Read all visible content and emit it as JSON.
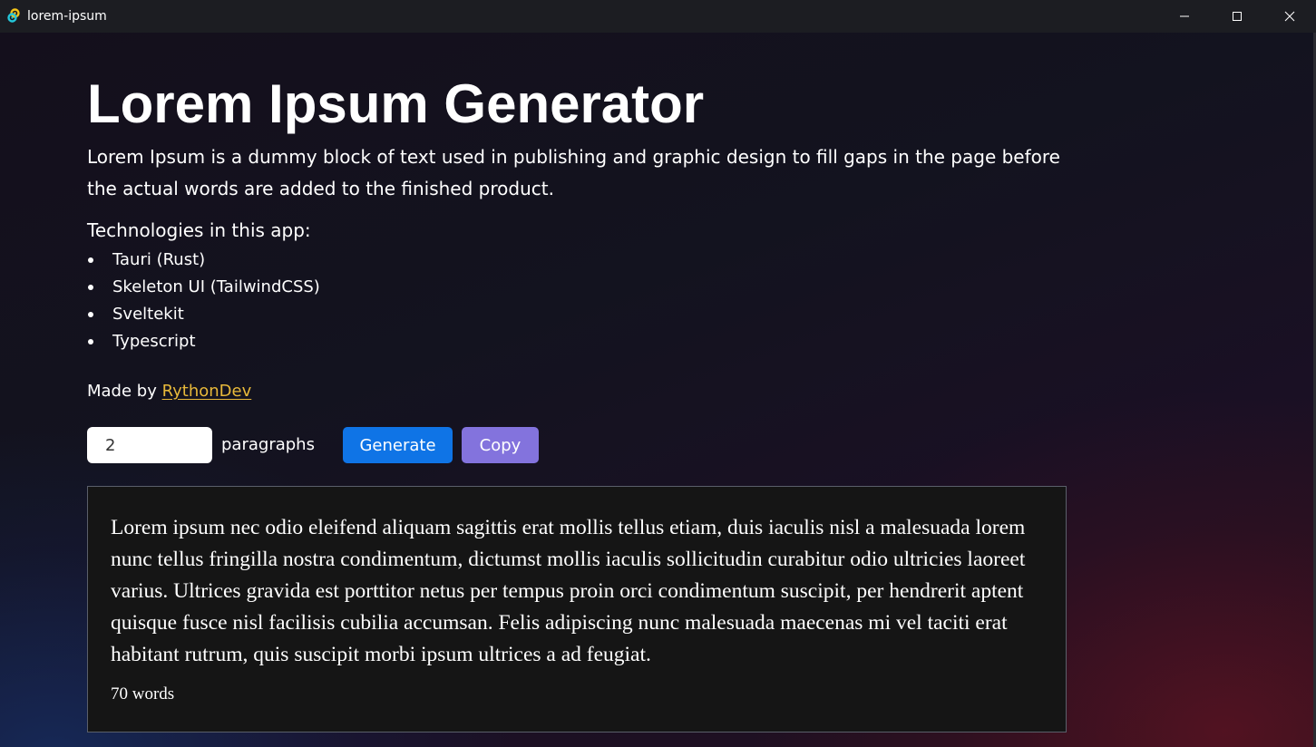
{
  "window": {
    "title": "lorem-ipsum",
    "app_icon": "tauri-logo-icon",
    "controls": {
      "minimize_icon": "minimize-icon",
      "maximize_icon": "maximize-icon",
      "close_icon": "close-icon"
    }
  },
  "page": {
    "title": "Lorem Ipsum Generator",
    "description": "Lorem Ipsum is a dummy block of text used in publishing and graphic design to fill gaps in the page before the actual words are added to the finished product.",
    "tech_heading": "Technologies in this app:",
    "technologies": [
      "Tauri (Rust)",
      "Skeleton UI (TailwindCSS)",
      "Sveltekit",
      "Typescript"
    ],
    "made_by_prefix": "Made by",
    "author_link": "RythonDev"
  },
  "generator": {
    "paragraph_count": "2",
    "paragraphs_label": "paragraphs",
    "generate_label": "Generate",
    "copy_label": "Copy"
  },
  "output": {
    "text": "Lorem ipsum nec odio eleifend aliquam sagittis erat mollis tellus etiam, duis iaculis nisl a malesuada lorem nunc tellus fringilla nostra condimentum, dictumst mollis iaculis sollicitudin curabitur odio ultricies laoreet varius. Ultrices gravida est porttitor netus per tempus proin orci condimentum suscipit, per hendrerit aptent quisque fusce nisl facilisis cubilia accumsan. Felis adipiscing nunc malesuada maecenas mi vel taciti erat habitant rutrum, quis suscipit morbi ipsum ultrices a ad feugiat.",
    "word_count": "70 words"
  },
  "colors": {
    "link": "#e8b93a",
    "generate_button": "#0f74e6",
    "copy_button": "#8373dd",
    "output_background": "#151515",
    "titlebar": "#1c1d22"
  }
}
